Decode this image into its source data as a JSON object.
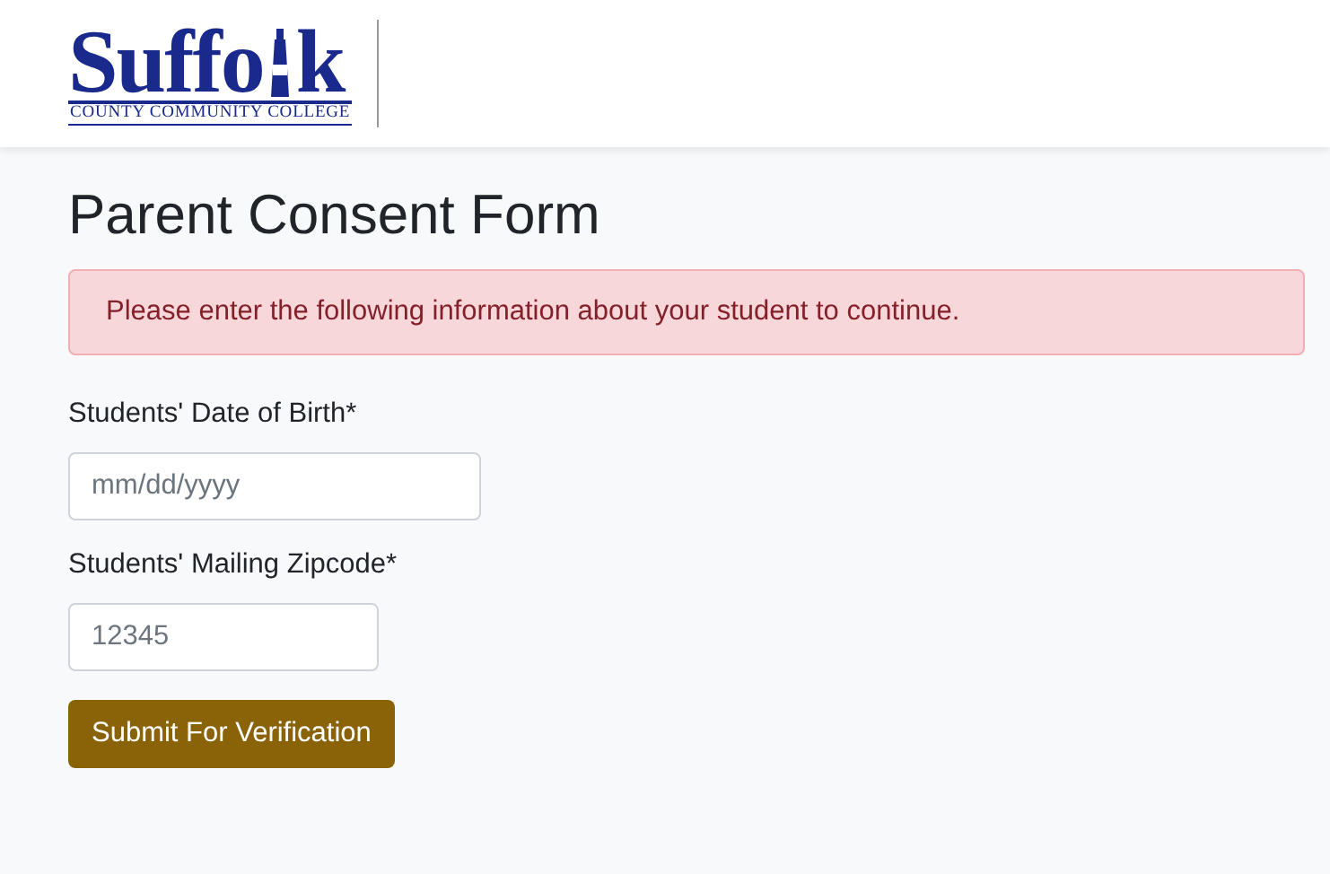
{
  "header": {
    "logo": {
      "name_before": "Suffo",
      "name_after": "k",
      "subtitle": "COUNTY COMMUNITY COLLEGE"
    }
  },
  "page": {
    "title": "Parent Consent Form",
    "alert": {
      "kind": "danger",
      "text": "Please enter the following information about your student to continue."
    },
    "fields": [
      {
        "label": "Students' Date of Birth*",
        "placeholder": "mm/dd/yyyy",
        "kind": "date"
      },
      {
        "label": "Students' Mailing Zipcode*",
        "placeholder": "12345",
        "kind": "zipcode"
      }
    ],
    "submit": {
      "label": "Submit For Verification"
    }
  }
}
